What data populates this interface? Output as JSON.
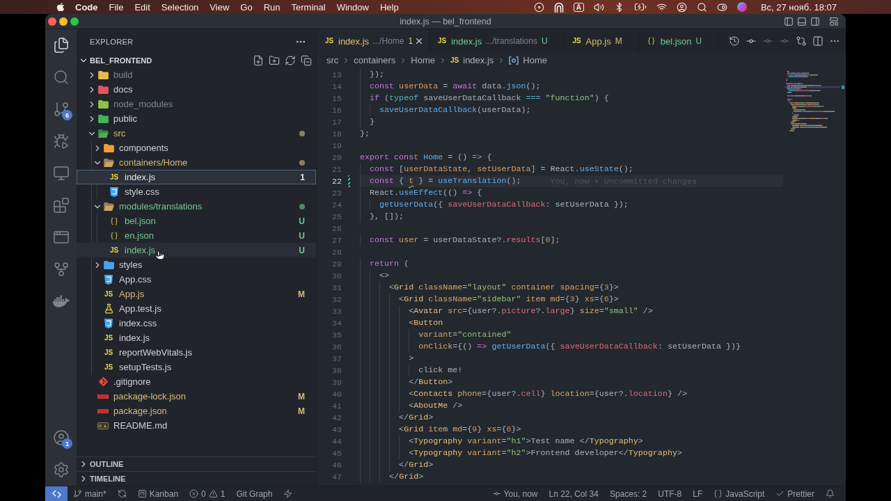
{
  "menu_bar": {
    "app": "Code",
    "items": [
      "File",
      "Edit",
      "Selection",
      "View",
      "Go",
      "Run",
      "Terminal",
      "Window",
      "Help"
    ],
    "input_source": "A",
    "clock": "Вс, 27 нояб. 18:07"
  },
  "window": {
    "title": "index.js — bel_frontend"
  },
  "activity_bar": {
    "top": [
      {
        "kind": "files",
        "selected": true
      },
      {
        "kind": "search",
        "selected": false
      },
      {
        "kind": "branch",
        "selected": false,
        "badge": "6"
      },
      {
        "kind": "debug",
        "selected": false
      },
      {
        "kind": "monitor",
        "selected": false
      },
      {
        "kind": "blocks",
        "selected": false
      },
      {
        "kind": "window",
        "selected": false
      },
      {
        "kind": "fork",
        "selected": false
      },
      {
        "kind": "whale",
        "selected": false
      }
    ],
    "bottom": [
      {
        "kind": "account",
        "selected": false,
        "badge": "1"
      },
      {
        "kind": "settings",
        "selected": false
      }
    ]
  },
  "sidebar": {
    "title": "EXPLORER",
    "project": {
      "name": "BEL_FRONTEND",
      "expanded": true
    },
    "tree": [
      {
        "name": "build",
        "kind": "build",
        "expanded": false,
        "color": "#7f848e",
        "dot": false,
        "selected": false,
        "hovered": false
      },
      {
        "name": "docs",
        "kind": "docs",
        "expanded": false,
        "color": "#cdd1d8",
        "dot": false,
        "selected": false,
        "hovered": false
      },
      {
        "name": "node_modules",
        "kind": "node",
        "expanded": false,
        "color": "#7f848e",
        "dot": false,
        "selected": false,
        "hovered": false
      },
      {
        "name": "public",
        "kind": "public",
        "expanded": false,
        "color": "#cdd1d8",
        "dot": false,
        "selected": false,
        "hovered": false
      },
      {
        "name": "src",
        "kind": "src",
        "expanded": true,
        "color": "#d7ba7d",
        "dot": true,
        "selected": false,
        "hovered": false,
        "children": [
          {
            "name": "components",
            "kind": "components",
            "expanded": false,
            "color": "#cdd1d8",
            "dot": false,
            "selected": false,
            "hovered": false
          },
          {
            "name": "containers/Home",
            "kind": "folder",
            "expanded": true,
            "color": "#d7ba7d",
            "dot": true,
            "selected": false,
            "hovered": false,
            "children": [
              {
                "name": "index.js",
                "kind": "js",
                "icon_text": "JS",
                "color": "#e6e8ec",
                "badge": "1",
                "selected": true,
                "hovered": false
              },
              {
                "name": "style.css",
                "kind": "css",
                "color": "#cdd1d8",
                "selected": false,
                "hovered": false
              }
            ]
          },
          {
            "name": "modules/translations",
            "kind": "folder",
            "expanded": true,
            "color": "#73c991",
            "dot": true,
            "selected": false,
            "hovered": false,
            "children": [
              {
                "name": "bel.json",
                "kind": "json",
                "icon_text": "{ }",
                "color": "#73c991",
                "badge": "U",
                "selected": false,
                "hovered": false
              },
              {
                "name": "en.json",
                "kind": "json",
                "icon_text": "{ }",
                "color": "#73c991",
                "badge": "U",
                "selected": false,
                "hovered": false
              },
              {
                "name": "index.js",
                "kind": "js",
                "icon_text": "JS",
                "color": "#73c991",
                "badge": "U",
                "selected": false,
                "hovered": true
              }
            ]
          },
          {
            "name": "styles",
            "kind": "styles",
            "expanded": false,
            "color": "#cdd1d8",
            "dot": false,
            "selected": false,
            "hovered": false
          },
          {
            "name": "App.css",
            "kind": "css",
            "color": "#cdd1d8",
            "selected": false,
            "hovered": false
          },
          {
            "name": "App.js",
            "kind": "js",
            "icon_text": "JS",
            "color": "#d7ba7d",
            "badge": "M",
            "selected": false,
            "hovered": false
          },
          {
            "name": "App.test.js",
            "kind": "test",
            "color": "#cdd1d8",
            "selected": false,
            "hovered": false
          },
          {
            "name": "index.css",
            "kind": "css",
            "color": "#cdd1d8",
            "selected": false,
            "hovered": false
          },
          {
            "name": "index.js",
            "kind": "js",
            "icon_text": "JS",
            "color": "#cdd1d8",
            "selected": false,
            "hovered": false
          },
          {
            "name": "reportWebVitals.js",
            "kind": "js",
            "icon_text": "JS",
            "color": "#cdd1d8",
            "selected": false,
            "hovered": false
          },
          {
            "name": "setupTests.js",
            "kind": "js",
            "icon_text": "JS",
            "color": "#cdd1d8",
            "selected": false,
            "hovered": false
          }
        ]
      },
      {
        "name": ".gitignore",
        "kind": "git",
        "color": "#cdd1d8",
        "selected": false,
        "hovered": false
      },
      {
        "name": "package-lock.json",
        "kind": "package",
        "color": "#d7ba7d",
        "badge": "M",
        "selected": false,
        "hovered": false
      },
      {
        "name": "package.json",
        "kind": "package",
        "color": "#d7ba7d",
        "badge": "M",
        "selected": false,
        "hovered": false
      },
      {
        "name": "README.md",
        "kind": "document",
        "color": "#cdd1d8",
        "selected": false,
        "hovered": false
      }
    ],
    "sections": [
      {
        "title": "OUTLINE",
        "expanded": false
      },
      {
        "title": "TIMELINE",
        "expanded": false
      }
    ]
  },
  "editor": {
    "tabs": [
      {
        "kind": "js",
        "icon_text": "JS",
        "name": "index.js",
        "description": ".../Home",
        "color": "#e5c07b",
        "badge": "1",
        "selected": true
      },
      {
        "kind": "js",
        "icon_text": "JS",
        "name": "index.js",
        "description": ".../translations",
        "color": "#73c991",
        "badge": "U",
        "selected": false
      },
      {
        "kind": "js",
        "icon_text": "JS",
        "name": "App.js",
        "color": "#d7ba7d",
        "badge": "M",
        "selected": false
      },
      {
        "kind": "json",
        "icon_text": "{ }",
        "name": "bel.json",
        "color": "#73c991",
        "badge": "U",
        "selected": false
      }
    ],
    "breadcrumb": [
      {
        "label": "src",
        "kind": "folder"
      },
      {
        "label": "containers",
        "kind": "folder"
      },
      {
        "label": "Home",
        "kind": "folder"
      },
      {
        "label": "index.js",
        "kind": "file",
        "icon_text": "JS"
      },
      {
        "label": "Home",
        "kind": "symbol"
      }
    ],
    "lines": [
      {
        "number": "13",
        "current": false,
        "modified": false,
        "tokens": [
          {
            "text": "  });",
            "kind": "plain"
          }
        ]
      },
      {
        "number": "14",
        "current": false,
        "modified": false,
        "tokens": [
          {
            "text": "  const",
            "kind": "keyword"
          },
          {
            "text": " userData",
            "kind": "variable"
          },
          {
            "text": " = ",
            "kind": "plain"
          },
          {
            "text": "await",
            "kind": "keyword"
          },
          {
            "text": " data.",
            "kind": "plain"
          },
          {
            "text": "json",
            "kind": "function"
          },
          {
            "text": "();",
            "kind": "plain"
          }
        ]
      },
      {
        "number": "15",
        "current": false,
        "modified": false,
        "tokens": [
          {
            "text": "  if",
            "kind": "keyword"
          },
          {
            "text": " (",
            "kind": "plain"
          },
          {
            "text": "typeof",
            "kind": "operator"
          },
          {
            "text": " saveUserDataCallback ",
            "kind": "plain"
          },
          {
            "text": "===",
            "kind": "operator"
          },
          {
            "text": " \"function\"",
            "kind": "string"
          },
          {
            "text": ") {",
            "kind": "plain"
          }
        ]
      },
      {
        "number": "16",
        "current": false,
        "modified": false,
        "tokens": [
          {
            "text": "    saveUserDataCallback",
            "kind": "function"
          },
          {
            "text": "(userData);",
            "kind": "plain"
          }
        ]
      },
      {
        "number": "17",
        "current": false,
        "modified": false,
        "tokens": [
          {
            "text": "  }",
            "kind": "plain"
          }
        ]
      },
      {
        "number": "18",
        "current": false,
        "modified": false,
        "tokens": [
          {
            "text": "};",
            "kind": "plain"
          }
        ]
      },
      {
        "number": "19",
        "current": false,
        "modified": false
      },
      {
        "number": "20",
        "current": false,
        "modified": false,
        "tokens": [
          {
            "text": "export const",
            "kind": "keyword"
          },
          {
            "text": " Home",
            "kind": "function"
          },
          {
            "text": " = () ",
            "kind": "plain"
          },
          {
            "text": "=>",
            "kind": "keyword"
          },
          {
            "text": " {",
            "kind": "plain"
          }
        ]
      },
      {
        "number": "21",
        "current": false,
        "modified": false,
        "tokens": [
          {
            "text": "  const",
            "kind": "keyword"
          },
          {
            "text": " [",
            "kind": "plain"
          },
          {
            "text": "userDataState",
            "kind": "variable"
          },
          {
            "text": ", ",
            "kind": "plain"
          },
          {
            "text": "setUserData",
            "kind": "variable"
          },
          {
            "text": "] = React.",
            "kind": "plain"
          },
          {
            "text": "useState",
            "kind": "function"
          },
          {
            "text": "();",
            "kind": "plain"
          }
        ]
      },
      {
        "number": "22",
        "current": true,
        "modified": true,
        "tokens": [
          {
            "text": "  const",
            "kind": "keyword"
          },
          {
            "text": " { ",
            "kind": "plain"
          },
          {
            "text": "t",
            "kind": "warning"
          },
          {
            "text": " } = ",
            "kind": "plain"
          },
          {
            "text": "useTranslation",
            "kind": "function"
          },
          {
            "text": "();",
            "kind": "plain"
          }
        ],
        "blame": "You, now • Uncommitted changes"
      },
      {
        "number": "23",
        "current": false,
        "modified": false,
        "tokens": [
          {
            "text": "  React.",
            "kind": "plain"
          },
          {
            "text": "useEffect",
            "kind": "function"
          },
          {
            "text": "(() ",
            "kind": "plain"
          },
          {
            "text": "=>",
            "kind": "keyword"
          },
          {
            "text": " {",
            "kind": "plain"
          }
        ]
      },
      {
        "number": "24",
        "current": false,
        "modified": false,
        "tokens": [
          {
            "text": "    getUserData",
            "kind": "function"
          },
          {
            "text": "({ ",
            "kind": "plain"
          },
          {
            "text": "saveUserDataCallback",
            "kind": "property"
          },
          {
            "text": ": setUserData });",
            "kind": "plain"
          }
        ]
      },
      {
        "number": "25",
        "current": false,
        "modified": false,
        "tokens": [
          {
            "text": "  }, []);",
            "kind": "plain"
          }
        ]
      },
      {
        "number": "26",
        "current": false,
        "modified": false
      },
      {
        "number": "27",
        "current": false,
        "modified": false,
        "tokens": [
          {
            "text": "  const",
            "kind": "keyword"
          },
          {
            "text": " user",
            "kind": "variable"
          },
          {
            "text": " = userDataState?.",
            "kind": "plain"
          },
          {
            "text": "results",
            "kind": "property"
          },
          {
            "text": "[",
            "kind": "plain"
          },
          {
            "text": "0",
            "kind": "number"
          },
          {
            "text": "];",
            "kind": "plain"
          }
        ]
      },
      {
        "number": "28",
        "current": false,
        "modified": false
      },
      {
        "number": "29",
        "current": false,
        "modified": false,
        "tokens": [
          {
            "text": "  return",
            "kind": "keyword"
          },
          {
            "text": " (",
            "kind": "plain"
          }
        ]
      },
      {
        "number": "30",
        "current": false,
        "modified": false,
        "tokens": [
          {
            "text": "    <>",
            "kind": "plain"
          }
        ]
      },
      {
        "number": "31",
        "current": false,
        "modified": false,
        "tokens": [
          {
            "text": "      <",
            "kind": "plain"
          },
          {
            "text": "Grid",
            "kind": "tag"
          },
          {
            "text": " className",
            "kind": "attribute"
          },
          {
            "text": "=",
            "kind": "plain"
          },
          {
            "text": "\"layout\"",
            "kind": "string"
          },
          {
            "text": " container spacing",
            "kind": "attribute"
          },
          {
            "text": "={",
            "kind": "plain"
          },
          {
            "text": "3",
            "kind": "number"
          },
          {
            "text": "}>",
            "kind": "plain"
          }
        ]
      },
      {
        "number": "32",
        "current": false,
        "modified": false,
        "tokens": [
          {
            "text": "        <",
            "kind": "plain"
          },
          {
            "text": "Grid",
            "kind": "tag"
          },
          {
            "text": " className",
            "kind": "attribute"
          },
          {
            "text": "=",
            "kind": "plain"
          },
          {
            "text": "\"sidebar\"",
            "kind": "string"
          },
          {
            "text": " item md",
            "kind": "attribute"
          },
          {
            "text": "={",
            "kind": "plain"
          },
          {
            "text": "3",
            "kind": "number"
          },
          {
            "text": "} ",
            "kind": "plain"
          },
          {
            "text": "xs",
            "kind": "attribute"
          },
          {
            "text": "={",
            "kind": "plain"
          },
          {
            "text": "6",
            "kind": "number"
          },
          {
            "text": "}>",
            "kind": "plain"
          }
        ]
      },
      {
        "number": "33",
        "current": false,
        "modified": false,
        "tokens": [
          {
            "text": "          <",
            "kind": "plain"
          },
          {
            "text": "Avatar",
            "kind": "tag"
          },
          {
            "text": " src",
            "kind": "attribute"
          },
          {
            "text": "={user?.",
            "kind": "plain"
          },
          {
            "text": "picture",
            "kind": "property"
          },
          {
            "text": "?.",
            "kind": "plain"
          },
          {
            "text": "large",
            "kind": "property"
          },
          {
            "text": "} ",
            "kind": "plain"
          },
          {
            "text": "size",
            "kind": "attribute"
          },
          {
            "text": "=",
            "kind": "plain"
          },
          {
            "text": "\"small\"",
            "kind": "string"
          },
          {
            "text": " />",
            "kind": "plain"
          }
        ]
      },
      {
        "number": "34",
        "current": false,
        "modified": false,
        "tokens": [
          {
            "text": "          <",
            "kind": "plain"
          },
          {
            "text": "Button",
            "kind": "tag"
          }
        ]
      },
      {
        "number": "35",
        "current": false,
        "modified": false,
        "tokens": [
          {
            "text": "            variant",
            "kind": "attribute"
          },
          {
            "text": "=",
            "kind": "plain"
          },
          {
            "text": "\"contained\"",
            "kind": "string"
          }
        ]
      },
      {
        "number": "36",
        "current": false,
        "modified": false,
        "tokens": [
          {
            "text": "            onClick",
            "kind": "attribute"
          },
          {
            "text": "={() ",
            "kind": "plain"
          },
          {
            "text": "=>",
            "kind": "keyword"
          },
          {
            "text": " getUserData",
            "kind": "function"
          },
          {
            "text": "({ ",
            "kind": "plain"
          },
          {
            "text": "saveUserDataCallback",
            "kind": "property"
          },
          {
            "text": ": setUserData })}",
            "kind": "plain"
          }
        ]
      },
      {
        "number": "37",
        "current": false,
        "modified": false,
        "tokens": [
          {
            "text": "          >",
            "kind": "plain"
          }
        ]
      },
      {
        "number": "38",
        "current": false,
        "modified": false,
        "tokens": [
          {
            "text": "            click me!",
            "kind": "plain"
          }
        ]
      },
      {
        "number": "39",
        "current": false,
        "modified": false,
        "tokens": [
          {
            "text": "          </",
            "kind": "plain"
          },
          {
            "text": "Button",
            "kind": "tag"
          },
          {
            "text": ">",
            "kind": "plain"
          }
        ]
      },
      {
        "number": "40",
        "current": false,
        "modified": false,
        "tokens": [
          {
            "text": "          <",
            "kind": "plain"
          },
          {
            "text": "Contacts",
            "kind": "tag"
          },
          {
            "text": " phone",
            "kind": "attribute"
          },
          {
            "text": "={user?.",
            "kind": "plain"
          },
          {
            "text": "cell",
            "kind": "property"
          },
          {
            "text": "} ",
            "kind": "plain"
          },
          {
            "text": "location",
            "kind": "attribute"
          },
          {
            "text": "={user?.",
            "kind": "plain"
          },
          {
            "text": "location",
            "kind": "property"
          },
          {
            "text": "} />",
            "kind": "plain"
          }
        ]
      },
      {
        "number": "41",
        "current": false,
        "modified": false,
        "tokens": [
          {
            "text": "          <",
            "kind": "plain"
          },
          {
            "text": "AboutMe",
            "kind": "tag"
          },
          {
            "text": " />",
            "kind": "plain"
          }
        ]
      },
      {
        "number": "42",
        "current": false,
        "modified": false,
        "tokens": [
          {
            "text": "        </",
            "kind": "plain"
          },
          {
            "text": "Grid",
            "kind": "tag"
          },
          {
            "text": ">",
            "kind": "plain"
          }
        ]
      },
      {
        "number": "43",
        "current": false,
        "modified": false,
        "tokens": [
          {
            "text": "        <",
            "kind": "plain"
          },
          {
            "text": "Grid",
            "kind": "tag"
          },
          {
            "text": " item md",
            "kind": "attribute"
          },
          {
            "text": "={",
            "kind": "plain"
          },
          {
            "text": "9",
            "kind": "number"
          },
          {
            "text": "} ",
            "kind": "plain"
          },
          {
            "text": "xs",
            "kind": "attribute"
          },
          {
            "text": "={",
            "kind": "plain"
          },
          {
            "text": "6",
            "kind": "number"
          },
          {
            "text": "}>",
            "kind": "plain"
          }
        ]
      },
      {
        "number": "44",
        "current": false,
        "modified": false,
        "tokens": [
          {
            "text": "          <",
            "kind": "plain"
          },
          {
            "text": "Typography",
            "kind": "tag"
          },
          {
            "text": " variant",
            "kind": "attribute"
          },
          {
            "text": "=",
            "kind": "plain"
          },
          {
            "text": "\"h1\"",
            "kind": "string"
          },
          {
            "text": ">Test name </",
            "kind": "plain"
          },
          {
            "text": "Typography",
            "kind": "tag"
          },
          {
            "text": ">",
            "kind": "plain"
          }
        ]
      },
      {
        "number": "45",
        "current": false,
        "modified": false,
        "tokens": [
          {
            "text": "          <",
            "kind": "plain"
          },
          {
            "text": "Typography",
            "kind": "tag"
          },
          {
            "text": " variant",
            "kind": "attribute"
          },
          {
            "text": "=",
            "kind": "plain"
          },
          {
            "text": "\"h2\"",
            "kind": "string"
          },
          {
            "text": ">Frontend developer</",
            "kind": "plain"
          },
          {
            "text": "Typography",
            "kind": "tag"
          },
          {
            "text": ">",
            "kind": "plain"
          }
        ]
      },
      {
        "number": "46",
        "current": false,
        "modified": false,
        "tokens": [
          {
            "text": "        </",
            "kind": "plain"
          },
          {
            "text": "Grid",
            "kind": "tag"
          },
          {
            "text": ">",
            "kind": "plain"
          }
        ]
      },
      {
        "number": "47",
        "current": false,
        "modified": false,
        "tokens": [
          {
            "text": "      </",
            "kind": "plain"
          },
          {
            "text": "Grid",
            "kind": "tag"
          },
          {
            "text": ">",
            "kind": "plain"
          }
        ]
      }
    ]
  },
  "status_bar": {
    "left": [
      {
        "kind": "remote"
      },
      {
        "kind": "branch",
        "text": "main*"
      },
      {
        "kind": "sync"
      },
      {
        "kind": "kanban",
        "text": "Kanban"
      },
      {
        "kind": "problems",
        "errors": "0",
        "warnings": "1"
      },
      {
        "kind": "plain",
        "text": "Git Graph"
      },
      {
        "kind": "bolt"
      }
    ],
    "right": [
      {
        "kind": "blame",
        "text": "You, now"
      },
      {
        "kind": "plain",
        "text": "Ln 22, Col 34"
      },
      {
        "kind": "plain",
        "text": "Spaces: 2"
      },
      {
        "kind": "plain",
        "text": "UTF-8"
      },
      {
        "kind": "plain",
        "text": "LF"
      },
      {
        "kind": "language",
        "text": "JavaScript"
      },
      {
        "kind": "formatter",
        "text": "Prettier"
      },
      {
        "kind": "bell"
      }
    ]
  }
}
